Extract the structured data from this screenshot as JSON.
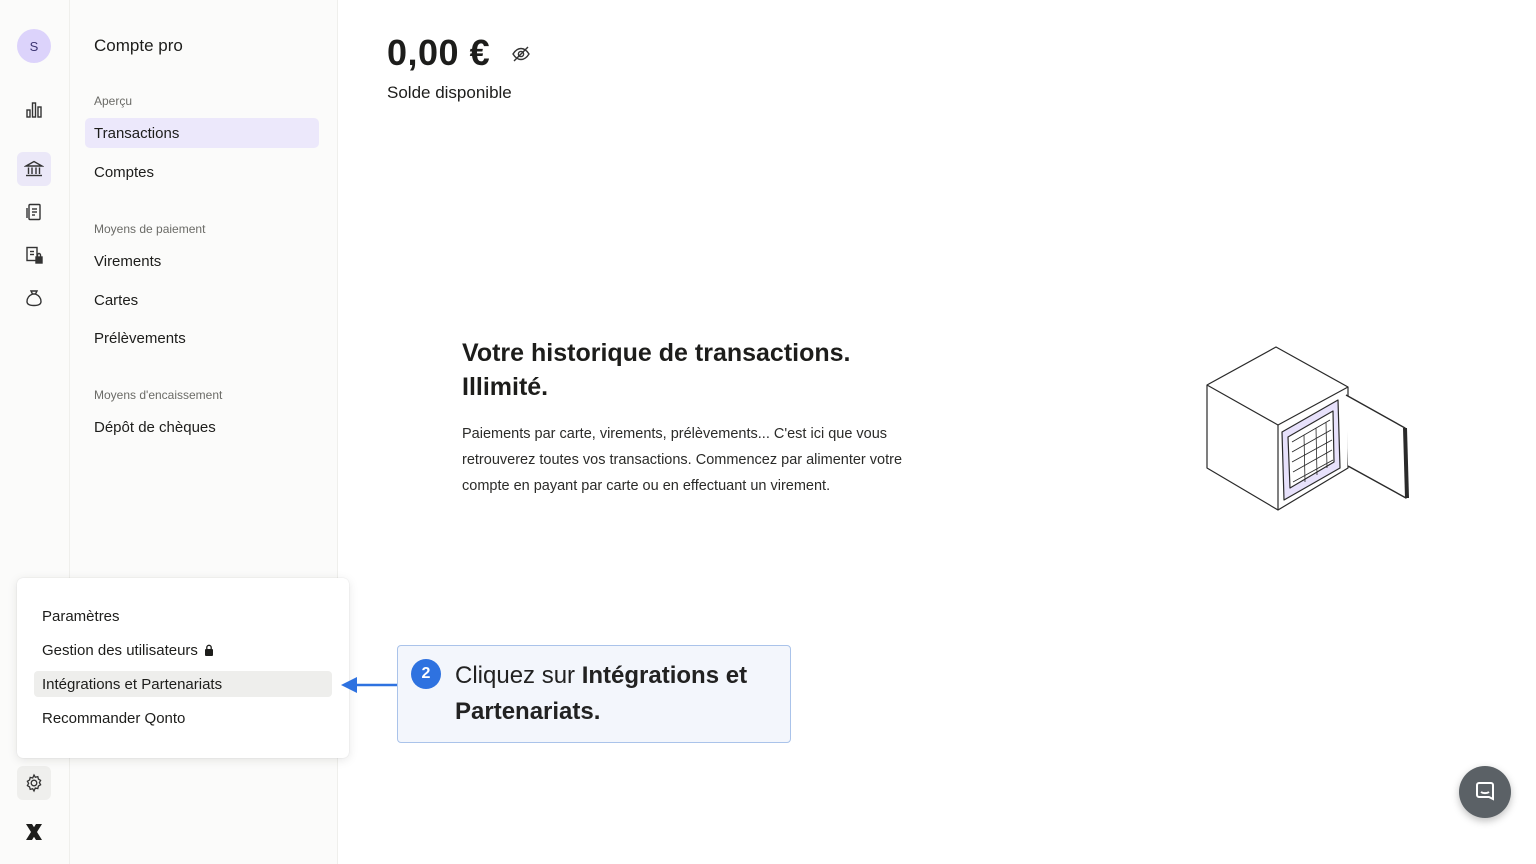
{
  "rail": {
    "avatar_initial": "S",
    "icons": [
      "bar-chart-icon",
      "bank-icon",
      "receipt-icon",
      "document-lock-icon",
      "money-bag-icon",
      "gear-icon",
      "qonto-logo-icon"
    ]
  },
  "subnav": {
    "title": "Compte pro",
    "sections": {
      "overview_label": "Aperçu",
      "payments_label": "Moyens de paiement",
      "collection_label": "Moyens d'encaissement"
    },
    "items": {
      "transactions": "Transactions",
      "accounts": "Comptes",
      "transfers": "Virements",
      "cards": "Cartes",
      "direct_debits": "Prélèvements",
      "cheques": "Dépôt de chèques"
    }
  },
  "popover": {
    "settings": "Paramètres",
    "users": "Gestion des utilisateurs",
    "integrations": "Intégrations et Partenariats",
    "refer": "Recommander Qonto"
  },
  "main": {
    "balance": "0,00 €",
    "balance_label": "Solde disponible",
    "empty_title_line1": "Votre historique de transactions.",
    "empty_title_line2": "Illimité.",
    "empty_body": "Paiements par carte, virements, prélèvements... C'est ici que vous retrouverez toutes vos transactions. Commencez par alimenter votre compte en payant par carte ou en effectuant un virement."
  },
  "callout": {
    "step": "2",
    "prefix": "Cliquez sur ",
    "emphasis": "Intégrations et Partenariats."
  },
  "colors": {
    "accent_purple": "#ece8fb",
    "callout_blue": "#2e72e0",
    "callout_bg": "#f3f6fc"
  }
}
